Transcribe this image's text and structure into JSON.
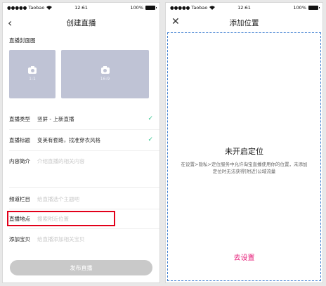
{
  "left": {
    "status": {
      "carrier": "●●●●● Taobao",
      "wifi": "wifi-icon",
      "time": "12:61",
      "battery": "100%"
    },
    "nav": {
      "title": "创建直播",
      "back_icon": "‹"
    },
    "cover_section": {
      "title": "直播封面图",
      "covers": [
        {
          "ratio": "1:1"
        },
        {
          "ratio": "16:9"
        }
      ]
    },
    "rows": [
      {
        "label": "直播类型",
        "value": "竖屏 - 上新直播",
        "check": "✓"
      },
      {
        "label": "直播标题",
        "value": "变美有套路，找准穿衣风格",
        "check": "✓"
      },
      {
        "label": "内容简介",
        "placeholder": "介绍直播的相关内容"
      },
      {
        "label": "频道栏目",
        "placeholder": "给直播选个主题吧"
      },
      {
        "label": "直播地点",
        "placeholder": "搜索附近位置"
      },
      {
        "label": "添加宝贝",
        "placeholder": "给直播添加相关宝贝"
      }
    ],
    "publish": "发布直播"
  },
  "right": {
    "status": {
      "carrier": "●●●●● Taobao",
      "wifi": "wifi-icon",
      "time": "12:61",
      "battery": "100%"
    },
    "nav": {
      "title": "添加位置",
      "close_icon": "✕"
    },
    "headline": "未开启定位",
    "description": "在设置>隐私>定位服务中允许淘宝直播使用你的位置，未添加定位时无法获得[附近]公域流量",
    "action": "去设置"
  },
  "colors": {
    "accent": "#e61c78",
    "check": "#2fc48b",
    "highlight": "#e2001a",
    "cover": "#bfc3d5"
  }
}
